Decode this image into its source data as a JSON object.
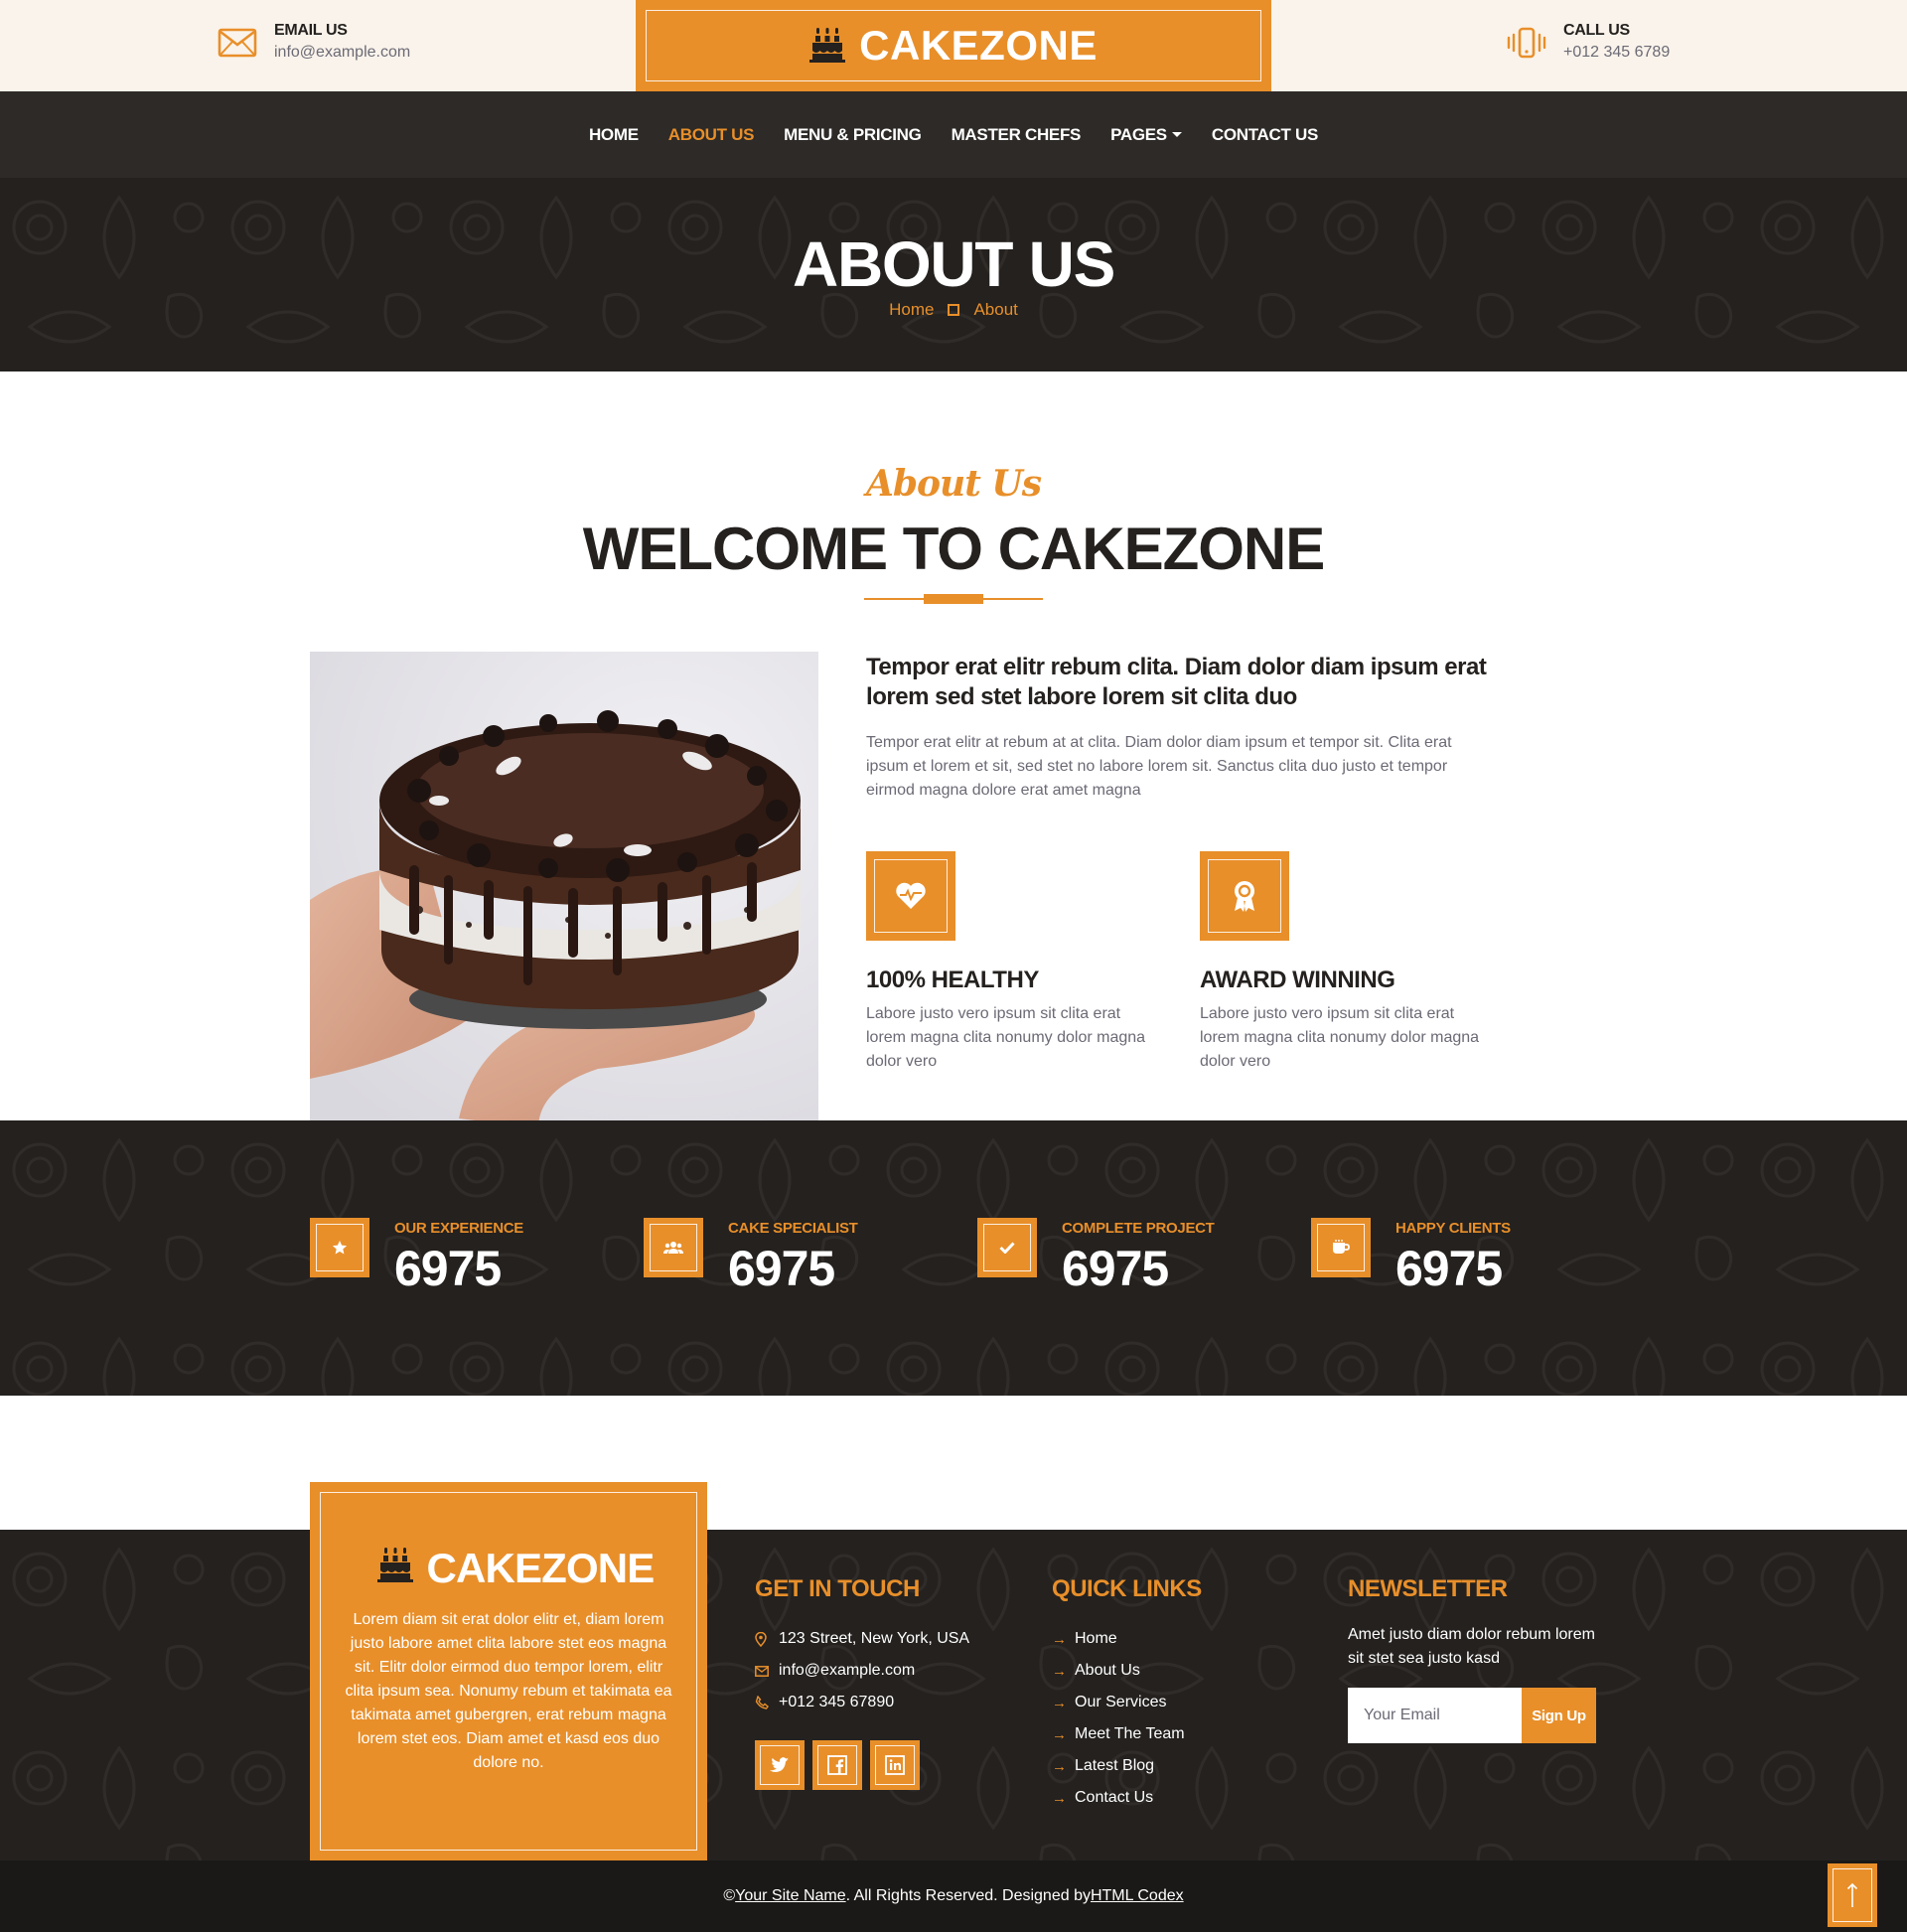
{
  "topbar": {
    "email": {
      "label": "EMAIL US",
      "value": "info@example.com",
      "icon": "envelope-icon"
    },
    "phone": {
      "label": "CALL US",
      "value": "+012 345 6789",
      "icon": "phone-vibrate-icon"
    },
    "brand": "CAKEZONE"
  },
  "nav": {
    "items": [
      {
        "label": "HOME"
      },
      {
        "label": "ABOUT US"
      },
      {
        "label": "MENU & PRICING"
      },
      {
        "label": "MASTER CHEFS"
      },
      {
        "label": "PAGES"
      },
      {
        "label": "CONTACT US"
      }
    ]
  },
  "hero": {
    "title": "ABOUT US",
    "breadcrumb": [
      "Home",
      "About"
    ]
  },
  "about": {
    "script": "About Us",
    "heading": "WELCOME TO CAKEZONE",
    "lead": "Tempor erat elitr rebum clita. Diam dolor diam ipsum erat lorem sed stet labore lorem sit clita duo",
    "text": "Tempor erat elitr at rebum at at clita. Diam dolor diam ipsum et tempor sit. Clita erat ipsum et lorem et sit, sed stet no labore lorem sit. Sanctus clita duo justo et tempor eirmod magna dolore erat amet magna",
    "features": [
      {
        "title": "100% HEALTHY",
        "text": "Labore justo vero ipsum sit clita erat lorem magna clita nonumy dolor magna dolor vero",
        "icon": "heart-pulse-icon"
      },
      {
        "title": "AWARD WINNING",
        "text": "Labore justo vero ipsum sit clita erat lorem magna clita nonumy dolor magna dolor vero",
        "icon": "award-icon"
      }
    ]
  },
  "stats": [
    {
      "label": "OUR EXPERIENCE",
      "value": "6975",
      "icon": "star-icon"
    },
    {
      "label": "CAKE SPECIALIST",
      "value": "6975",
      "icon": "users-icon"
    },
    {
      "label": "COMPLETE PROJECT",
      "value": "6975",
      "icon": "check-icon"
    },
    {
      "label": "HAPPY CLIENTS",
      "value": "6975",
      "icon": "mug-icon"
    }
  ],
  "footer": {
    "brand": "CAKEZONE",
    "brand_text": "Lorem diam sit erat dolor elitr et, diam lorem justo labore amet clita labore stet eos magna sit. Elitr dolor eirmod duo tempor lorem, elitr clita ipsum sea. Nonumy rebum et takimata ea takimata amet gubergren, erat rebum magna lorem stet eos. Diam amet et kasd eos duo dolore no.",
    "touch": {
      "title": "GET IN TOUCH",
      "address": "123 Street, New York, USA",
      "email": "info@example.com",
      "phone": "+012 345 67890"
    },
    "links": {
      "title": "QUICK LINKS",
      "items": [
        "Home",
        "About Us",
        "Our Services",
        "Meet The Team",
        "Latest Blog",
        "Contact Us"
      ]
    },
    "newsletter": {
      "title": "NEWSLETTER",
      "text": "Amet justo diam dolor rebum lorem sit stet sea justo kasd",
      "placeholder": "Your Email",
      "button": "Sign Up"
    },
    "copyright": {
      "prefix": "© ",
      "site": "Your Site Name",
      "middle": ". All Rights Reserved. Designed by ",
      "designer": "HTML Codex"
    }
  },
  "colors": {
    "accent": "#e88f2a",
    "dark": "#24211f",
    "cream": "#faf3eb"
  }
}
